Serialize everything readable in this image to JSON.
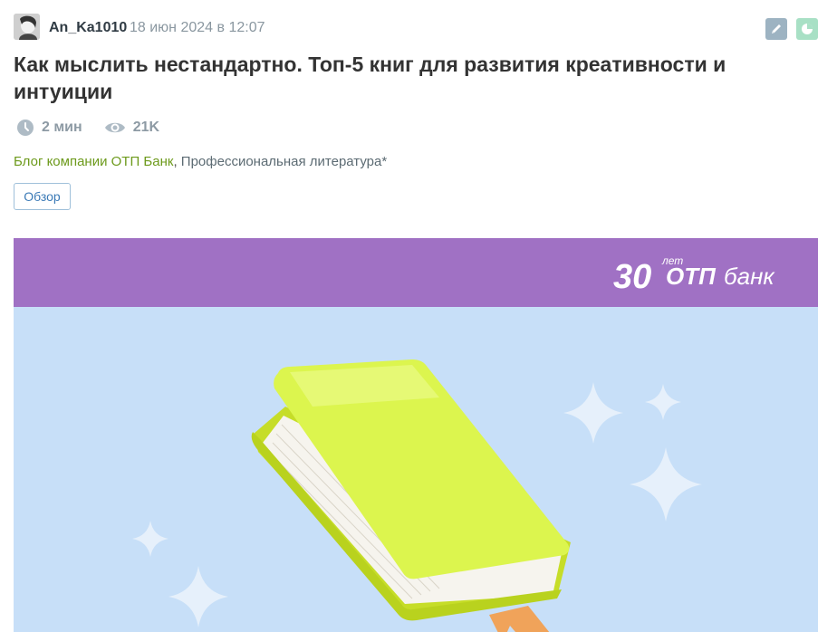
{
  "author": {
    "username": "An_Ka1010",
    "date": "18 июн 2024 в 12:07"
  },
  "toolbar": {
    "edit_icon": "pencil-icon",
    "stats_icon": "pie-chart-icon"
  },
  "article": {
    "title": "Как мыслить нестандартно. Топ-5 книг для развития креативности и интуиции",
    "reading_time": "2 мин",
    "views": "21K",
    "hubs": [
      {
        "label": "Блог компании ОТП Банк",
        "link": true
      },
      {
        "label": "Профессиональная литература*",
        "link": false
      }
    ],
    "hub_separator": ", ",
    "tag": "Обзор"
  },
  "banner": {
    "logo_number": "30",
    "logo_superscript": "лет",
    "logo_brand_bold": "ОТП",
    "logo_brand_rest": "банк",
    "colors": {
      "top_band": "#a071c4",
      "background": "#c7dff8",
      "book_cover": "#d9f24a",
      "bookmark": "#f0a35a"
    }
  },
  "colors": {
    "hub_link": "#6d9a1c",
    "meta_text": "#8d9aa4",
    "tag_border": "#9fc0da"
  }
}
